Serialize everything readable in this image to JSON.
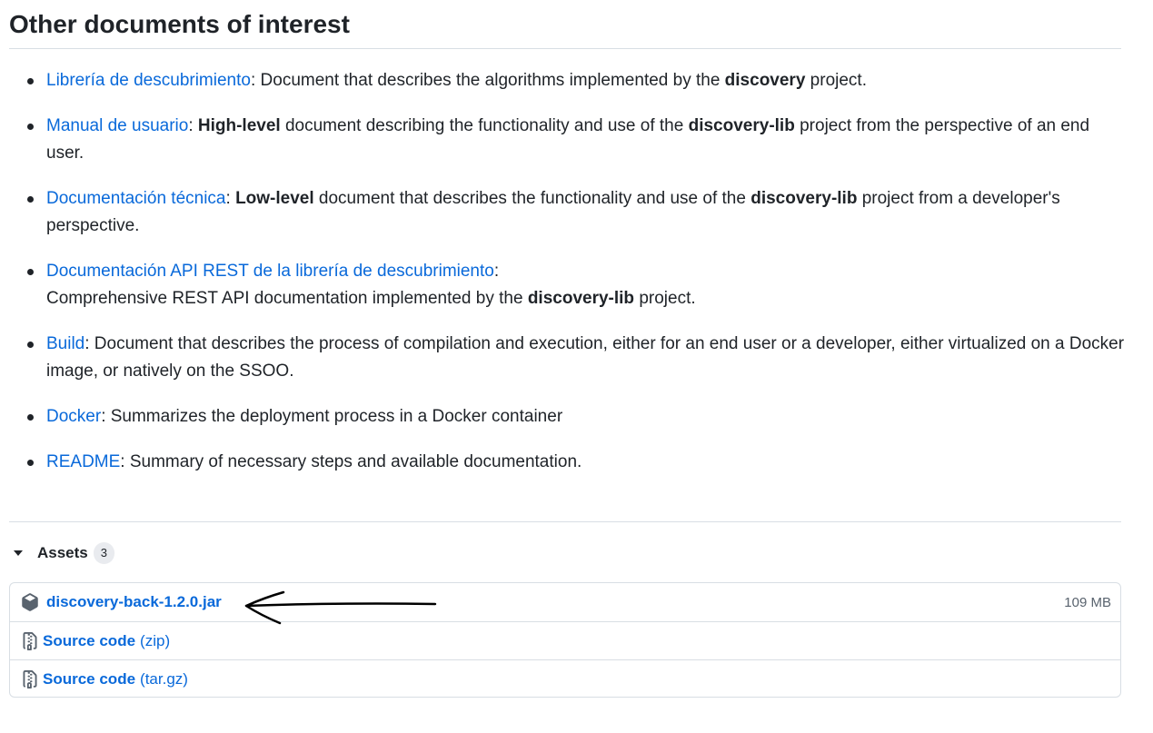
{
  "page": {
    "title": "Other documents of interest"
  },
  "documents": [
    {
      "link": "Librería de descubrimiento",
      "parts": [
        {
          "text": ": Document that describes the algorithms implemented by the ",
          "bold": false
        },
        {
          "text": "discovery",
          "bold": true
        },
        {
          "text": " project.",
          "bold": false
        }
      ]
    },
    {
      "link": "Manual de usuario",
      "parts": [
        {
          "text": ": ",
          "bold": false
        },
        {
          "text": "High-level",
          "bold": true
        },
        {
          "text": " document describing the functionality and use of the ",
          "bold": false
        },
        {
          "text": "discovery-lib",
          "bold": true
        },
        {
          "text": " project from the perspective of an end user.",
          "bold": false
        }
      ]
    },
    {
      "link": "Documentación técnica",
      "parts": [
        {
          "text": ": ",
          "bold": false
        },
        {
          "text": "Low-level",
          "bold": true
        },
        {
          "text": " document that describes the functionality and use of the ",
          "bold": false
        },
        {
          "text": "discovery-lib",
          "bold": true
        },
        {
          "text": " project from a developer's perspective.",
          "bold": false
        }
      ]
    },
    {
      "link": "Documentación API REST de la librería de descubrimiento",
      "parts": [
        {
          "text": ":",
          "bold": false
        },
        {
          "text": "\n",
          "bold": false
        },
        {
          "text": "Comprehensive REST API documentation implemented by the ",
          "bold": false
        },
        {
          "text": "discovery-lib",
          "bold": true
        },
        {
          "text": " project.",
          "bold": false
        }
      ]
    },
    {
      "link": "Build",
      "parts": [
        {
          "text": ": Document that describes the process of compilation and execution, either for an end user or a developer, either virtualized on a Docker image, or natively on the SSOO.",
          "bold": false
        }
      ]
    },
    {
      "link": "Docker",
      "parts": [
        {
          "text": ": Summarizes the deployment process in a Docker container",
          "bold": false
        }
      ]
    },
    {
      "link": "README",
      "parts": [
        {
          "text": ": Summary of necessary steps and available documentation.",
          "bold": false
        }
      ]
    }
  ],
  "assets": {
    "label": "Assets",
    "count": "3",
    "items": [
      {
        "name": "discovery-back-1.2.0.jar",
        "suffix": "",
        "size": "109 MB",
        "icon": "package-icon"
      },
      {
        "name": "Source code",
        "suffix": "(zip)",
        "size": "",
        "icon": "file-zip-icon"
      },
      {
        "name": "Source code",
        "suffix": "(tar.gz)",
        "size": "",
        "icon": "file-zip-icon"
      }
    ]
  },
  "colors": {
    "link": "#0969da",
    "text": "#1f2328",
    "muted": "#59636e",
    "border": "#d8dee4",
    "counter_bg": "#e9ebef"
  }
}
